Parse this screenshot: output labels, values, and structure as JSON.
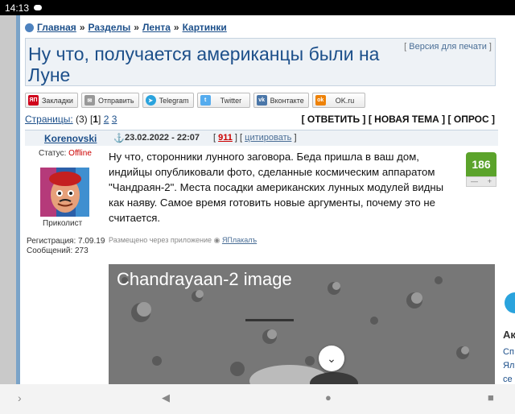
{
  "status_bar": {
    "time": "14:13"
  },
  "breadcrumbs": [
    {
      "label": "Главная"
    },
    {
      "label": "Разделы"
    },
    {
      "label": "Лента"
    },
    {
      "label": "Картинки"
    }
  ],
  "breadcrumb_separator": "»",
  "topic": {
    "title": "Ну что, получается американцы были на Луне",
    "print_version": "Версия для печати"
  },
  "share_buttons": [
    {
      "label": "Закладки",
      "icon": "yandex-icon",
      "icon_text": "ЯП",
      "color": "#d0021b"
    },
    {
      "label": "Отправить",
      "icon": "mail-icon",
      "icon_text": "✉",
      "color": "#999999"
    },
    {
      "label": "Telegram",
      "icon": "telegram-icon",
      "icon_text": "➤",
      "color": "#2aa3dd"
    },
    {
      "label": "Twitter",
      "icon": "twitter-icon",
      "icon_text": "t",
      "color": "#55acee"
    },
    {
      "label": "Вконтакте",
      "icon": "vk-icon",
      "icon_text": "vk",
      "color": "#4a76a8"
    },
    {
      "label": "OK.ru",
      "icon": "ok-icon",
      "icon_text": "ok",
      "color": "#ee8208"
    }
  ],
  "pagination": {
    "label": "Страницы:",
    "count": "(3)",
    "pages": [
      "1",
      "2",
      "3"
    ],
    "current": "1"
  },
  "actions": {
    "reply": "[ ОТВЕТИТЬ ]",
    "new_topic": "[ НОВАЯ ТЕМА ]",
    "poll": "[ ОПРОС ]"
  },
  "post": {
    "author": "Korenovski",
    "status_label": "Статус:",
    "status_value": "Offline",
    "rank": "Приколист",
    "registration": "Регистрация: 7.09.19",
    "messages": "Сообщений: 273",
    "date": "23.02.2022 - 22:07",
    "number": "911",
    "cite": "цитировать",
    "text": "Ну что, сторонники лунного заговора. Беда пришла в ваш дом, индийцы опубликовали фото, сделанные космическим аппаратом \"Чандраян-2\". Места посадки американских лунных модулей видны как наяву. Самое время готовить новые аргументы, почему это не считается.",
    "rating": "186",
    "rating_minus": "—",
    "rating_plus": "+",
    "via_text": "Размещено через приложение",
    "via_app": "ЯПлакалъ",
    "image_caption": "Chandrayaan-2 image"
  },
  "sidebar": {
    "heading": "Ак",
    "links": [
      "Сп",
      "Ял",
      "се"
    ]
  },
  "colors": {
    "link": "#1c4f8a",
    "offline": "#cc0000",
    "rating_green": "#5ba32b"
  }
}
